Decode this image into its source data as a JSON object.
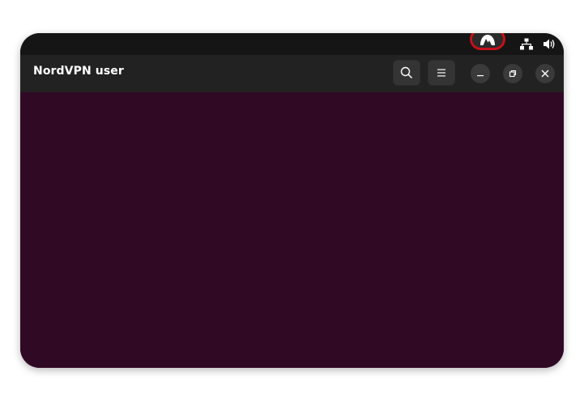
{
  "window": {
    "title": "NordVPN user",
    "content_background": "#300a24"
  },
  "topbar": {
    "tray": [
      {
        "name": "nordvpn-tray-icon",
        "icon": "nordvpn-mountain-icon",
        "highlight_color": "#c4101a"
      },
      {
        "name": "network-tray-icon",
        "icon": "network-wired-icon"
      },
      {
        "name": "volume-tray-icon",
        "icon": "volume-icon"
      }
    ]
  },
  "headerbar": {
    "buttons": [
      {
        "name": "search-button",
        "icon": "search-icon"
      },
      {
        "name": "menu-button",
        "icon": "hamburger-menu-icon"
      }
    ],
    "window_controls": [
      {
        "name": "minimize-button",
        "icon": "minimize-icon"
      },
      {
        "name": "maximize-button",
        "icon": "restore-icon"
      },
      {
        "name": "close-button",
        "icon": "close-icon"
      }
    ]
  }
}
